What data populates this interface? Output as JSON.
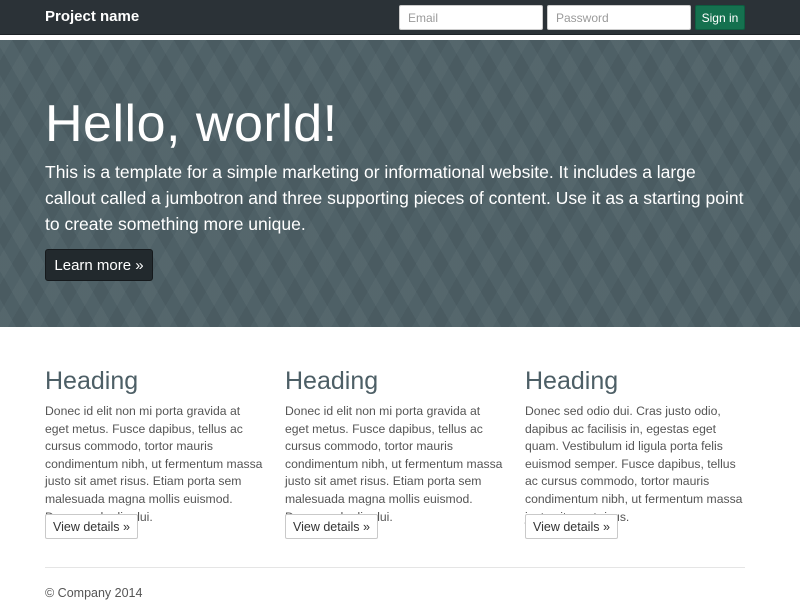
{
  "navbar": {
    "brand": "Project name",
    "email_placeholder": "Email",
    "password_placeholder": "Password",
    "signin_label": "Sign in"
  },
  "jumbotron": {
    "title": "Hello, world!",
    "lead": "This is a template for a simple marketing or informational website. It includes a large callout called a jumbotron and three supporting pieces of content. Use it as a starting point to create something more unique.",
    "button_label": "Learn more »"
  },
  "columns": [
    {
      "heading": "Heading",
      "text": "Donec id elit non mi porta gravida at eget metus. Fusce dapibus, tellus ac cursus commodo, tortor mauris condimentum nibh, ut fermentum massa justo sit amet risus. Etiam porta sem malesuada magna mollis euismod. Donec sed odio dui.",
      "button_label": "View details »"
    },
    {
      "heading": "Heading",
      "text": "Donec id elit non mi porta gravida at eget metus. Fusce dapibus, tellus ac cursus commodo, tortor mauris condimentum nibh, ut fermentum massa justo sit amet risus. Etiam porta sem malesuada magna mollis euismod. Donec sed odio dui.",
      "button_label": "View details »"
    },
    {
      "heading": "Heading",
      "text": "Donec sed odio dui. Cras justo odio, dapibus ac facilisis in, egestas eget quam. Vestibulum id ligula porta felis euismod semper. Fusce dapibus, tellus ac cursus commodo, tortor mauris condimentum nibh, ut fermentum massa justo sit amet risus.",
      "button_label": "View details »"
    }
  ],
  "footer": {
    "text": "© Company 2014"
  },
  "colors": {
    "navbar_bg": "#2b3237",
    "jumbotron_bg": "#4e6066",
    "signin_button": "#15714f",
    "learn_button": "#22292d",
    "heading_color": "#4d5f66"
  }
}
